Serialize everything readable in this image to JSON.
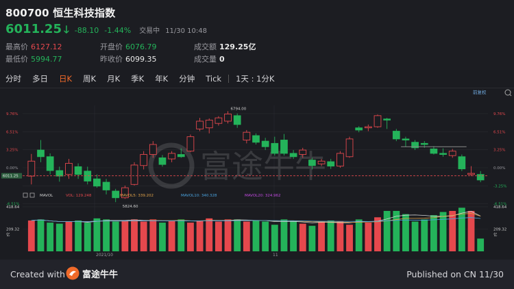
{
  "header": {
    "title": "800700 恒生科技指数",
    "price": "6011.25",
    "change": "-88.10",
    "change_pct": "-1.44%",
    "status": "交易中",
    "time": "11/30 10:48",
    "stats": {
      "high_label": "最高价",
      "high_value": "6127.12",
      "low_label": "最低价",
      "low_value": "5994.77",
      "open_label": "开盘价",
      "open_value": "6076.79",
      "prev_close_label": "昨收价",
      "prev_close_value": "6099.35",
      "turnover_label": "成交额",
      "turnover_value": "129.25亿",
      "volume_label": "成交量",
      "volume_value": "0"
    }
  },
  "tabs": [
    "分时",
    "多日",
    "日K",
    "周K",
    "月K",
    "季K",
    "年K",
    "分钟",
    "Tick",
    "1天 : 1分K"
  ],
  "active_tab": "日K",
  "chart": {
    "adjust_label": "前复权",
    "watermark": "富途牛牛",
    "right_pct_labels": [
      "9.76%",
      "6.51%",
      "3.25%",
      "0.00%",
      "-3.25%",
      "-6.51%"
    ],
    "left_pct_labels": [
      "9.76%",
      "6.51%",
      "3.25%",
      "0.00%",
      "-3.25%",
      "-6.51%"
    ],
    "current_price_tag": "6011.25",
    "high_annotation": "6794.00",
    "low_annotation": "5824.60",
    "vol_legend": {
      "name": "MAVOL",
      "vol": "VOL: 129.248",
      "mavol5": "MAVOL5: 339.202",
      "mavol10": "MAVOL10: 340.328",
      "mavol20": "MAVOL20: 324.962"
    },
    "vol_axis_left": [
      "418.64",
      "209.32",
      "亿"
    ],
    "vol_axis_right": [
      "418.64",
      "209.32",
      "亿"
    ],
    "x_labels": [
      "2021/10",
      "11"
    ],
    "colors": {
      "up": "#e5484d",
      "down": "#24b35a",
      "ma5": "#d8d8d8",
      "ma10": "#e0a34a",
      "ma20": "#4aa3df",
      "ma30": "#c04adf"
    }
  },
  "candles": [
    {
      "o": -1.5,
      "c": 1.2,
      "h": 2.5,
      "l": -3.0
    },
    {
      "o": 3.2,
      "c": 2.0,
      "h": 5.0,
      "l": 1.0
    },
    {
      "o": 2.0,
      "c": -0.5,
      "h": 2.6,
      "l": -1.2
    },
    {
      "o": -0.5,
      "c": -1.5,
      "h": 0.2,
      "l": -2.5
    },
    {
      "o": -1.2,
      "c": 0.8,
      "h": 1.6,
      "l": -2.0
    },
    {
      "o": 0.2,
      "c": -1.2,
      "h": 0.8,
      "l": -2.0
    },
    {
      "o": -0.6,
      "c": -2.4,
      "h": 0.2,
      "l": -3.0
    },
    {
      "o": -2.0,
      "c": -3.3,
      "h": -1.2,
      "l": -3.6
    },
    {
      "o": -2.6,
      "c": -4.0,
      "h": -2.0,
      "l": -4.8
    },
    {
      "o": -4.2,
      "c": -5.4,
      "h": -3.8,
      "l": -6.2
    },
    {
      "o": -5.4,
      "c": -3.6,
      "h": -3.2,
      "l": -5.6
    },
    {
      "o": -3.0,
      "c": 0.5,
      "h": 1.0,
      "l": -3.2
    },
    {
      "o": 0.4,
      "c": 2.4,
      "h": 3.0,
      "l": -0.3
    },
    {
      "o": 2.4,
      "c": 4.2,
      "h": 4.8,
      "l": 1.8
    },
    {
      "o": 1.8,
      "c": 0.6,
      "h": 2.3,
      "l": 0.2
    },
    {
      "o": 1.6,
      "c": 2.6,
      "h": 3.0,
      "l": 1.0
    },
    {
      "o": 2.4,
      "c": 2.0,
      "h": 3.5,
      "l": 1.8
    },
    {
      "o": 3.0,
      "c": 5.6,
      "h": 6.0,
      "l": 2.8
    },
    {
      "o": 7.0,
      "c": 8.4,
      "h": 9.0,
      "l": 6.6
    },
    {
      "o": 7.2,
      "c": 8.6,
      "h": 8.9,
      "l": 6.2
    },
    {
      "o": 8.0,
      "c": 9.0,
      "h": 9.3,
      "l": 7.6
    },
    {
      "o": 8.4,
      "c": 9.7,
      "h": 10.2,
      "l": 8.0
    },
    {
      "o": 9.4,
      "c": 7.8,
      "h": 9.8,
      "l": 7.2
    },
    {
      "o": 5.0,
      "c": 6.4,
      "h": 6.8,
      "l": 4.4
    },
    {
      "o": 5.8,
      "c": 4.6,
      "h": 6.2,
      "l": 4.2
    },
    {
      "o": 4.8,
      "c": 3.8,
      "h": 5.4,
      "l": 3.2
    },
    {
      "o": 4.4,
      "c": 2.6,
      "h": 5.6,
      "l": 2.2
    },
    {
      "o": 5.0,
      "c": 2.6,
      "h": 6.1,
      "l": 2.2
    },
    {
      "o": 2.6,
      "c": 2.0,
      "h": 3.2,
      "l": 1.6
    },
    {
      "o": 2.4,
      "c": 3.2,
      "h": 3.6,
      "l": 1.8
    },
    {
      "o": 1.4,
      "c": 0.4,
      "h": 1.8,
      "l": -0.3
    },
    {
      "o": 0.7,
      "c": 1.2,
      "h": 1.6,
      "l": 0.3
    },
    {
      "o": 1.1,
      "c": 0.3,
      "h": 1.6,
      "l": -0.2
    },
    {
      "o": 0.3,
      "c": 2.6,
      "h": 3.0,
      "l": 0.0
    },
    {
      "o": 2.0,
      "c": 5.2,
      "h": 5.6,
      "l": 1.8
    },
    {
      "o": 7.2,
      "c": 6.8,
      "h": 7.5,
      "l": 6.4
    },
    {
      "o": 7.2,
      "c": 7.4,
      "h": 7.8,
      "l": 6.6
    },
    {
      "o": 7.4,
      "c": 9.4,
      "h": 9.6,
      "l": 7.2
    },
    {
      "o": 8.8,
      "c": 8.6,
      "h": 9.0,
      "l": 7.0
    },
    {
      "o": 6.6,
      "c": 5.2,
      "h": 7.0,
      "l": 4.8
    },
    {
      "o": 5.2,
      "c": 5.0,
      "h": 5.6,
      "l": 3.8
    },
    {
      "o": 4.6,
      "c": 3.6,
      "h": 5.0,
      "l": 3.2
    },
    {
      "o": 4.4,
      "c": 4.2,
      "h": 4.8,
      "l": 3.6
    },
    {
      "o": 3.4,
      "c": 2.6,
      "h": 3.9,
      "l": 2.4
    },
    {
      "o": 2.6,
      "c": 2.4,
      "h": 3.5,
      "l": 2.0
    },
    {
      "o": 2.2,
      "c": 3.0,
      "h": 3.4,
      "l": 1.8
    },
    {
      "o": 2.0,
      "c": -0.2,
      "h": 2.4,
      "l": -0.6
    },
    {
      "o": -1.2,
      "c": -1.0,
      "h": 0.3,
      "l": -1.5
    },
    {
      "o": -1.2,
      "c": -2.2,
      "h": -0.6,
      "l": -2.6
    }
  ],
  "volumes": [
    290,
    300,
    270,
    260,
    280,
    290,
    270,
    310,
    300,
    280,
    290,
    300,
    280,
    300,
    270,
    290,
    300,
    270,
    290,
    310,
    280,
    300,
    300,
    280,
    290,
    280,
    250,
    300,
    290,
    260,
    240,
    280,
    290,
    280,
    250,
    300,
    270,
    320,
    380,
    380,
    350,
    280,
    300,
    340,
    370,
    380,
    410,
    380,
    120
  ]
}
